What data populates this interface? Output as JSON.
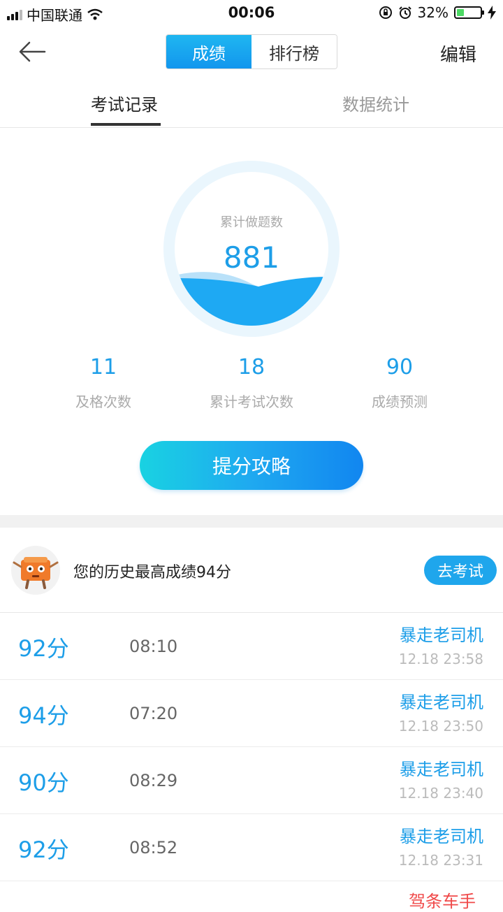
{
  "status_bar": {
    "carrier": "中国联通",
    "time": "00:06",
    "battery_percent": "32%",
    "battery_level": 0.32
  },
  "nav": {
    "segments": [
      "成绩",
      "排行榜"
    ],
    "active_segment": 0,
    "edit_label": "编辑"
  },
  "tabs": {
    "record": "考试记录",
    "stats": "数据统计"
  },
  "summary": {
    "circle_label": "累计做题数",
    "circle_value": "881",
    "stats": [
      {
        "value": "11",
        "label": "及格次数"
      },
      {
        "value": "18",
        "label": "累计考试次数"
      },
      {
        "value": "90",
        "label": "成绩预测"
      }
    ],
    "tips_button": "提分攻略"
  },
  "best": {
    "text": "您的历史最高成绩94分",
    "button": "去考试"
  },
  "records": [
    {
      "score": "92分",
      "duration": "08:10",
      "title": "暴走老司机",
      "time": "12.18 23:58"
    },
    {
      "score": "94分",
      "duration": "07:20",
      "title": "暴走老司机",
      "time": "12.18 23:50"
    },
    {
      "score": "90分",
      "duration": "08:29",
      "title": "暴走老司机",
      "time": "12.18 23:40"
    },
    {
      "score": "92分",
      "duration": "08:52",
      "title": "暴走老司机",
      "time": "12.18 23:31"
    }
  ],
  "partial_title": "驾条车手",
  "colors": {
    "accent": "#1d9ee8",
    "wave": "#1ea9f3",
    "partial_red": "#f04a4a"
  }
}
